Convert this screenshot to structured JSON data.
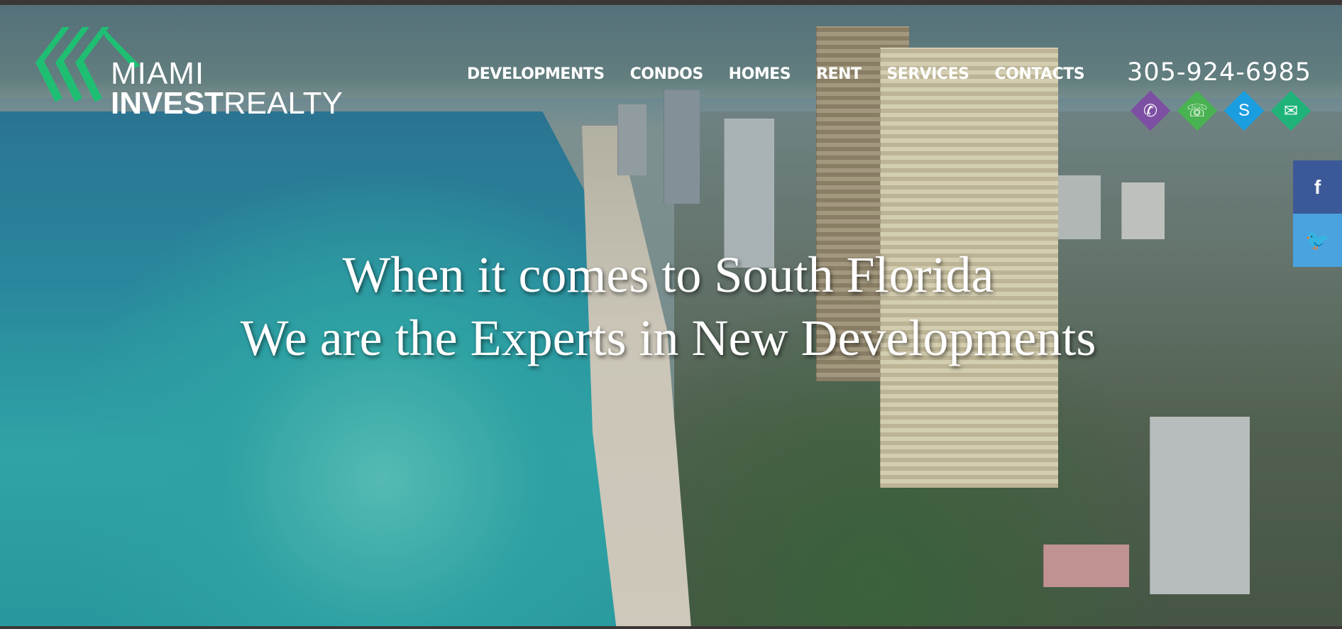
{
  "brand": {
    "line1": "MIAMI",
    "line2_bold": "INVEST",
    "line2_regular": "REALTY",
    "accent": "#1fbf73"
  },
  "nav": {
    "items": [
      {
        "label": "DEVELOPMENTS"
      },
      {
        "label": "CONDOS"
      },
      {
        "label": "HOMES"
      },
      {
        "label": "RENT"
      },
      {
        "label": "SERVICES"
      },
      {
        "label": "CONTACTS"
      }
    ]
  },
  "contact": {
    "phone": "305-924-6985",
    "icons": [
      {
        "name": "viber-icon",
        "color": "#7d4fa3",
        "glyph": "✆"
      },
      {
        "name": "whatsapp-icon",
        "color": "#49b351",
        "glyph": "☏"
      },
      {
        "name": "skype-icon",
        "color": "#1a9ee0",
        "glyph": "S"
      },
      {
        "name": "email-icon",
        "color": "#1fb37a",
        "glyph": "✉"
      }
    ]
  },
  "social": {
    "facebook": {
      "glyph": "f",
      "color": "#3b5998"
    },
    "twitter": {
      "glyph": "🐦",
      "color": "#4aa3df"
    }
  },
  "hero": {
    "line1": "When it comes to South Florida",
    "line2": "We are the Experts in New Developments"
  }
}
